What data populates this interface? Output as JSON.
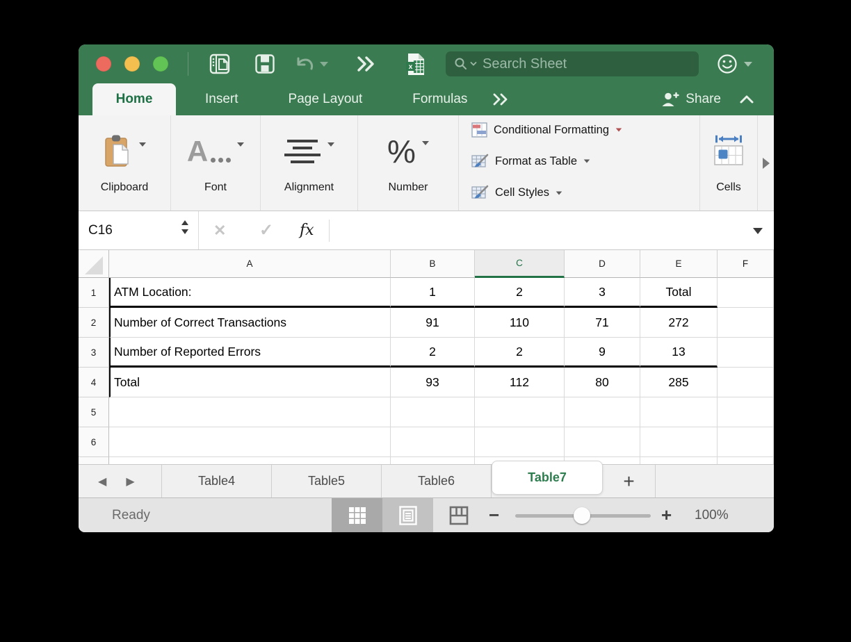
{
  "titlebar": {
    "search_placeholder": "Search Sheet"
  },
  "ribbon_tabs": {
    "home": "Home",
    "insert": "Insert",
    "page_layout": "Page Layout",
    "formulas": "Formulas",
    "share": "Share"
  },
  "ribbon": {
    "groups": {
      "clipboard": "Clipboard",
      "font": "Font",
      "alignment": "Alignment",
      "number": "Number",
      "cells": "Cells"
    },
    "buttons": {
      "conditional_formatting": "Conditional Formatting",
      "format_as_table": "Format as Table",
      "cell_styles": "Cell Styles"
    }
  },
  "formula_bar": {
    "cell_reference": "C16",
    "fx_label": "fx"
  },
  "grid": {
    "column_headers": [
      "A",
      "B",
      "C",
      "D",
      "E",
      "F"
    ],
    "selected_column": "C",
    "rows": [
      {
        "n": "1",
        "cells": [
          "ATM Location:",
          "1",
          "2",
          "3",
          "Total",
          ""
        ]
      },
      {
        "n": "2",
        "cells": [
          "Number of Correct Transactions",
          "91",
          "110",
          "71",
          "272",
          ""
        ]
      },
      {
        "n": "3",
        "cells": [
          "Number of Reported Errors",
          "2",
          "2",
          "9",
          "13",
          ""
        ]
      },
      {
        "n": "4",
        "cells": [
          "Total",
          "93",
          "112",
          "80",
          "285",
          ""
        ]
      },
      {
        "n": "5",
        "cells": [
          "",
          "",
          "",
          "",
          "",
          ""
        ]
      },
      {
        "n": "6",
        "cells": [
          "",
          "",
          "",
          "",
          "",
          ""
        ]
      }
    ]
  },
  "sheet_tabs": {
    "tabs": [
      "Table4",
      "Table5",
      "Table6",
      "Table7"
    ],
    "active": "Table7",
    "add_label": "+"
  },
  "status_bar": {
    "status": "Ready",
    "zoom_level": "100%"
  },
  "colors": {
    "titlebar_green": "#3B7B51",
    "accent_green": "#217346"
  }
}
